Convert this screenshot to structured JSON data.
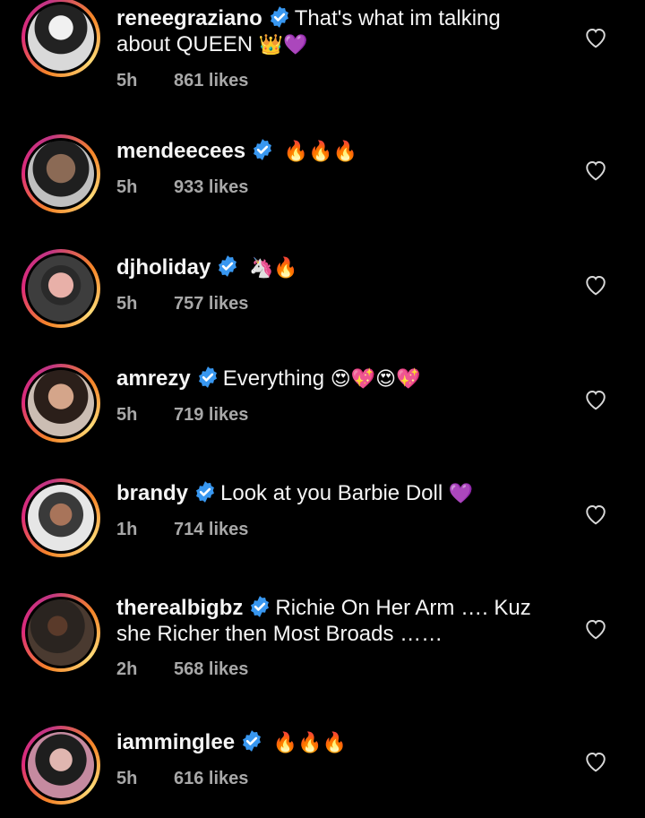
{
  "comments": [
    {
      "user": "reneegraziano",
      "text": "That's what im talking about QUEEN",
      "emoji": "👑💜",
      "time": "5h",
      "likes": "861 likes"
    },
    {
      "user": "mendeecees",
      "text": "",
      "emoji": "🔥🔥🔥",
      "time": "5h",
      "likes": "933 likes"
    },
    {
      "user": "djholiday",
      "text": "",
      "emoji": "🦄🔥",
      "time": "5h",
      "likes": "757 likes"
    },
    {
      "user": "amrezy",
      "text": "Everything",
      "emoji": "😍💖😍💖",
      "time": "5h",
      "likes": "719 likes"
    },
    {
      "user": "brandy",
      "text": "Look at you Barbie Doll",
      "emoji": "💜",
      "time": "1h",
      "likes": "714 likes"
    },
    {
      "user": "therealbigbz",
      "text": "Richie On Her Arm …. Kuz she Richer then Most Broads ……",
      "emoji": "",
      "time": "2h",
      "likes": "568 likes"
    },
    {
      "user": "iamminglee",
      "text": "",
      "emoji": "🔥🔥🔥",
      "time": "5h",
      "likes": "616 likes"
    }
  ],
  "colors": {
    "background": "#000000",
    "verified": "#3897f0",
    "meta": "#a8a8a8",
    "text": "#f5f5f5"
  },
  "icons": {
    "verified": "verified-badge-icon",
    "like": "heart-outline-icon"
  }
}
